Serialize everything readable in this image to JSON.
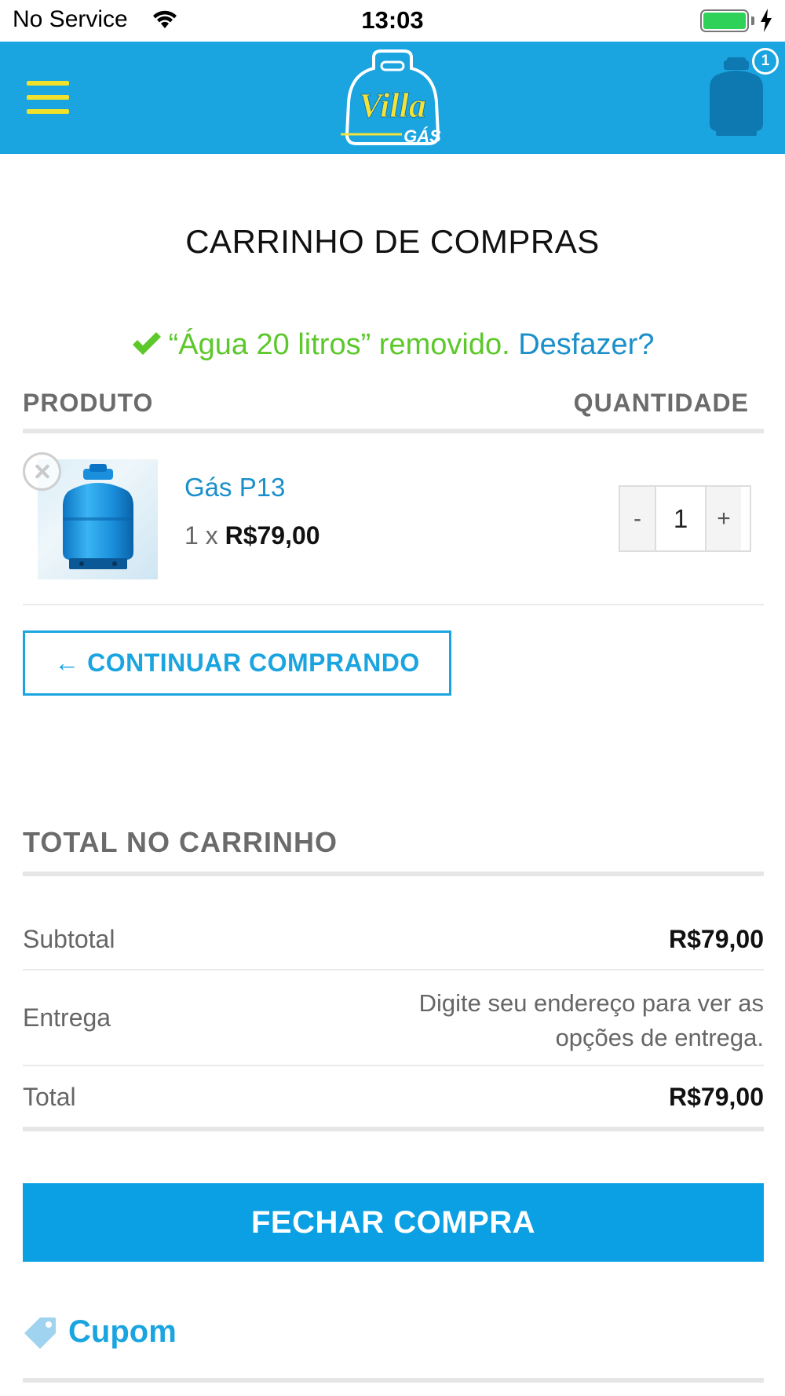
{
  "status_bar": {
    "carrier": "No Service",
    "time": "13:03",
    "battery_color": "#2fd158"
  },
  "header": {
    "menu_icon": "hamburger-icon",
    "logo_text": "Villa",
    "logo_subtext": "GÁS",
    "cart_icon": "gas-cylinder-icon",
    "cart_count": "1",
    "background": "#1aa4e0"
  },
  "page": {
    "title": "CARRINHO DE COMPRAS"
  },
  "notice": {
    "icon": "checkmark-icon",
    "message": "“Água 20 litros” removido.",
    "undo_label": "Desfazer?",
    "color": "#5cc82b"
  },
  "table": {
    "col_product": "PRODUTO",
    "col_quantity": "QUANTIDADE"
  },
  "cart_items": [
    {
      "name": "Gás P13",
      "qty_prefix": "1 x",
      "price": "R$79,00",
      "quantity": "1",
      "minus_label": "-",
      "plus_label": "+",
      "remove_icon": "close-circle-icon",
      "image_icon": "gas-cylinder-icon"
    }
  ],
  "continue_button": {
    "label": "← CONTINUAR COMPRANDO"
  },
  "totals": {
    "title": "TOTAL NO CARRINHO",
    "subtotal_label": "Subtotal",
    "subtotal_value": "R$79,00",
    "shipping_label": "Entrega",
    "shipping_value": "Digite seu endereço para ver as opções de entrega.",
    "total_label": "Total",
    "total_value": "R$79,00"
  },
  "checkout_button": {
    "label": "FECHAR COMPRA",
    "color": "#0aa0e3"
  },
  "coupon": {
    "icon": "tag-icon",
    "label": "Cupom"
  }
}
